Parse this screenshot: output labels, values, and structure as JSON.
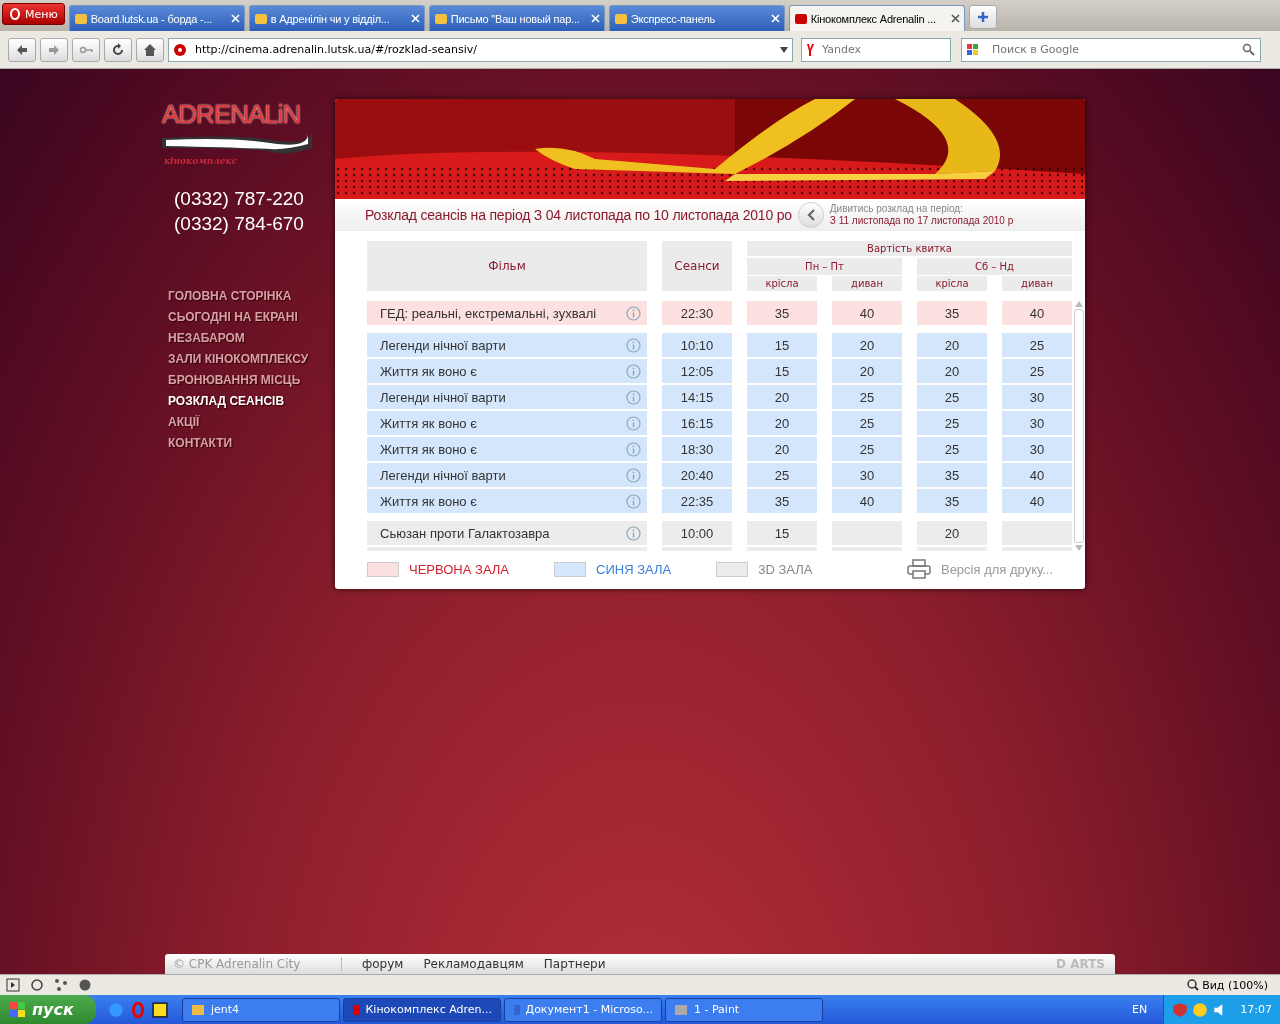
{
  "browser": {
    "menu_label": "Меню",
    "tabs": [
      {
        "title": "Board.lutsk.ua - борда -...",
        "selected": false
      },
      {
        "title": "в Адренілін чи у відділ...",
        "selected": false
      },
      {
        "title": "Письмо \"Ваш новый пар...",
        "selected": false
      },
      {
        "title": "Экспресс-панель",
        "selected": false
      },
      {
        "title": "Кінокомплекс Adrenalin ...",
        "selected": true
      }
    ],
    "address": "http://cinema.adrenalin.lutsk.ua/#/rozklad-seansiv/",
    "search_fields": [
      {
        "placeholder": "Yandex"
      },
      {
        "placeholder": "Поиск в Google"
      }
    ]
  },
  "site": {
    "logo": {
      "name": "ADRENALiN",
      "subtitle": "кінокомплекс"
    },
    "phones": [
      "(0332) 787-220",
      "(0332) 784-670"
    ],
    "nav": [
      {
        "label": "ГОЛОВНА СТОРІНКА",
        "selected": false
      },
      {
        "label": "СЬОГОДНІ НА ЕКРАНІ",
        "selected": false
      },
      {
        "label": "НЕЗАБАРОМ",
        "selected": false
      },
      {
        "label": "ЗАЛИ КІНОКОМПЛЕКСУ",
        "selected": false
      },
      {
        "label": "БРОНЮВАННЯ МІСЦЬ",
        "selected": false
      },
      {
        "label": "РОЗКЛАД СЕАНСІВ",
        "selected": true
      },
      {
        "label": "АКЦІЇ",
        "selected": false
      },
      {
        "label": "КОНТАКТИ",
        "selected": false
      }
    ],
    "schedule": {
      "title": "Розклад сеансів на період З 04 листопада по 10 листопада 2010 ро",
      "next_label": "Дивитись розклад на період:",
      "next_period": "З 11 листопада по 17 листопада 2010 р",
      "columns": {
        "film": "Фільм",
        "sessions": "Сеанси",
        "price": "Вартість квитка",
        "weekdays": "Пн – Пт",
        "weekend": "Сб – Нд",
        "seat_1": "крісла",
        "sofa_1": "диван",
        "seat_2": "крісла",
        "sofa_2": "диван"
      },
      "rows": [
        {
          "kind": "red",
          "film": "ГЕД: реальні, екстремальні, зухвалі",
          "time": "22:30",
          "prices": {
            "weekday_seat": "35",
            "weekday_sofa": "40",
            "weekend_seat": "35",
            "weekend_sofa": "40"
          }
        },
        {
          "kind": "blue",
          "film": "Легенди нічної варти",
          "time": "10:10",
          "prices": {
            "weekday_seat": "15",
            "weekday_sofa": "20",
            "weekend_seat": "20",
            "weekend_sofa": "25"
          }
        },
        {
          "kind": "blue",
          "film": "Життя як воно є",
          "time": "12:05",
          "prices": {
            "weekday_seat": "15",
            "weekday_sofa": "20",
            "weekend_seat": "20",
            "weekend_sofa": "25"
          }
        },
        {
          "kind": "blue",
          "film": "Легенди нічної варти",
          "time": "14:15",
          "prices": {
            "weekday_seat": "20",
            "weekday_sofa": "25",
            "weekend_seat": "25",
            "weekend_sofa": "30"
          }
        },
        {
          "kind": "blue",
          "film": "Життя як воно є",
          "time": "16:15",
          "prices": {
            "weekday_seat": "20",
            "weekday_sofa": "25",
            "weekend_seat": "25",
            "weekend_sofa": "30"
          }
        },
        {
          "kind": "blue",
          "film": "Життя як воно є",
          "time": "18:30",
          "prices": {
            "weekday_seat": "20",
            "weekday_sofa": "25",
            "weekend_seat": "25",
            "weekend_sofa": "30"
          }
        },
        {
          "kind": "blue",
          "film": "Легенди нічної варти",
          "time": "20:40",
          "prices": {
            "weekday_seat": "25",
            "weekday_sofa": "30",
            "weekend_seat": "35",
            "weekend_sofa": "40"
          }
        },
        {
          "kind": "blue",
          "film": "Життя як воно є",
          "time": "22:35",
          "prices": {
            "weekday_seat": "35",
            "weekday_sofa": "40",
            "weekend_seat": "35",
            "weekend_sofa": "40"
          }
        },
        {
          "kind": "grey",
          "film": "Сьюзан проти Галактозавра",
          "time": "10:00",
          "prices": {
            "weekday_seat": "15",
            "weekend_seat": "20"
          }
        }
      ],
      "legend": [
        {
          "kind": "red",
          "label": "ЧЕРВОНА ЗАЛА"
        },
        {
          "kind": "blue",
          "label": "СИНЯ ЗАЛА"
        },
        {
          "kind": "grey",
          "label": "3D ЗАЛА"
        }
      ],
      "print_label": "Версія для друку..."
    },
    "footer": {
      "copyright": "© CPK Adrenalin City",
      "links": [
        "форум",
        "Рекламодавцям",
        "Партнери"
      ],
      "brand": "D ARTS"
    }
  },
  "status_bar": {
    "zoom": "Вид (100%)"
  },
  "taskbar": {
    "start": "пуск",
    "tasks": [
      {
        "title": "jent4",
        "selected": false
      },
      {
        "title": "Кінокомплекс Adren...",
        "selected": true
      },
      {
        "title": "Документ1 - Microso...",
        "selected": false
      },
      {
        "title": "1 - Paint",
        "selected": false
      }
    ],
    "lang": "EN",
    "clock": "17:07"
  }
}
